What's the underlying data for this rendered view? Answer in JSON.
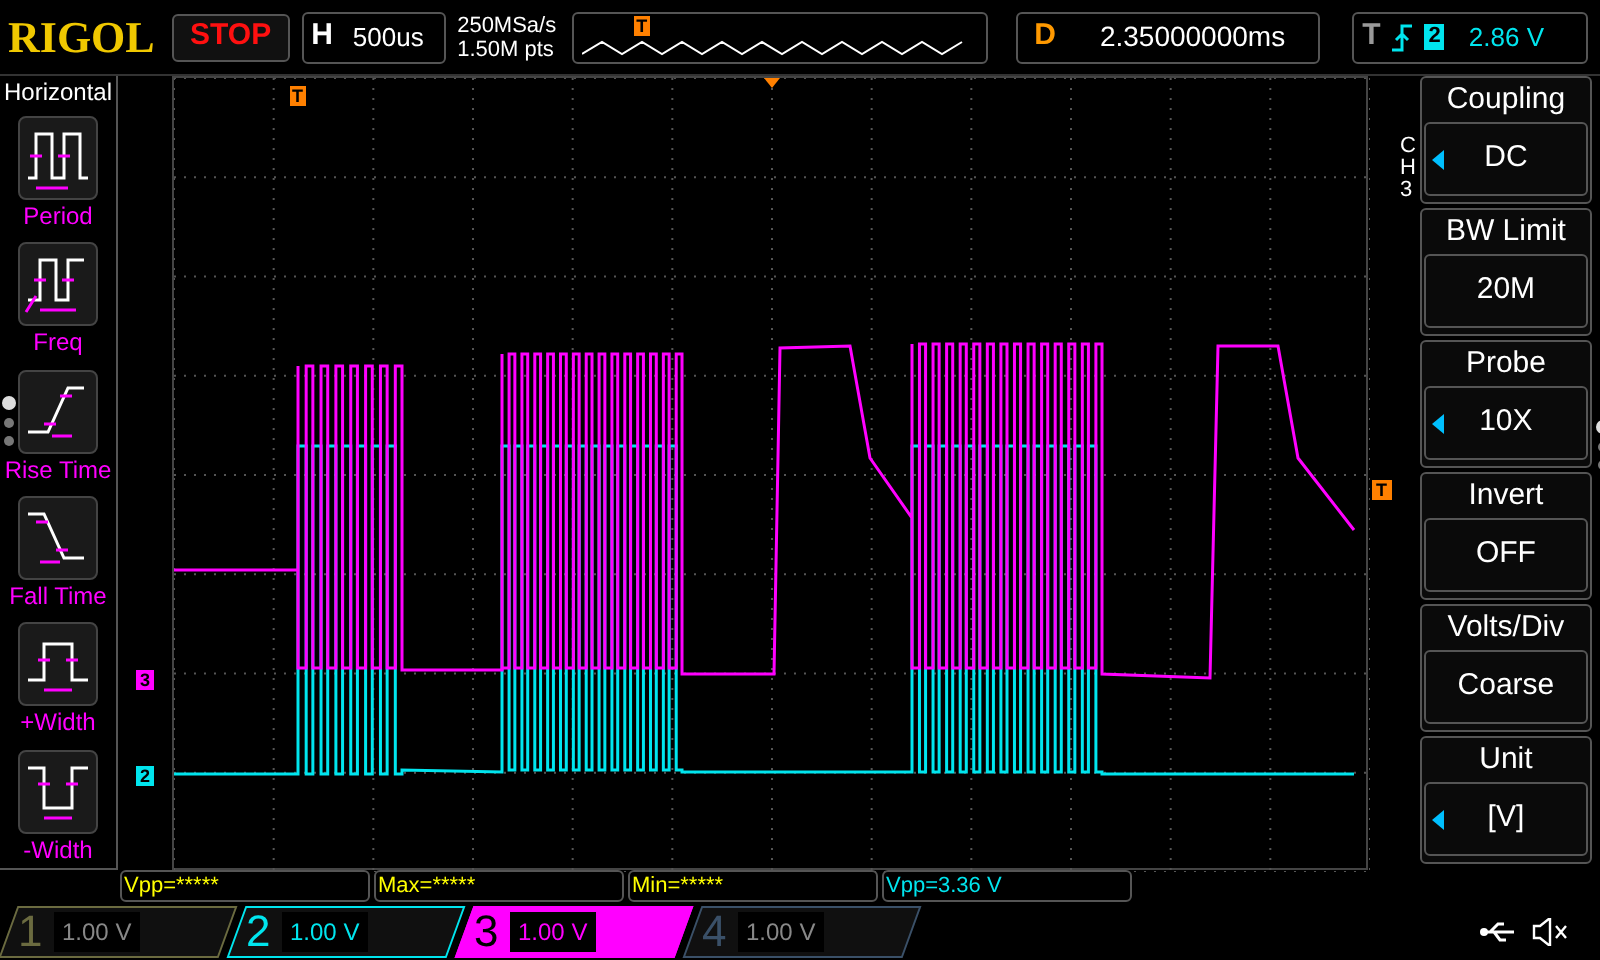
{
  "top_bar": {
    "logo": "RIGOL",
    "run_status": "STOP",
    "horizontal": {
      "label": "H",
      "timebase": "500us"
    },
    "sample_rate": "250MSa/s",
    "memory_depth": "1.50M pts",
    "delay": {
      "label": "D",
      "value": "2.35000000ms"
    },
    "trigger": {
      "label": "T",
      "source": "2",
      "level": "2.86 V"
    }
  },
  "memory_overview": {
    "trigger_marker": "T"
  },
  "plot": {
    "trigger_position_marker": "T",
    "trigger_level_marker": "T"
  },
  "channel_markers": [
    {
      "label": "3",
      "color": "#ff00ff"
    },
    {
      "label": "2",
      "color": "#00e5ee"
    }
  ],
  "left_menu": {
    "title": "Horizontal",
    "items": [
      {
        "kind": "period",
        "label": "Period"
      },
      {
        "kind": "freq",
        "label": "Freq"
      },
      {
        "kind": "rise",
        "label": "Rise Time"
      },
      {
        "kind": "fall",
        "label": "Fall Time"
      },
      {
        "kind": "pwidth",
        "label": "+Width"
      },
      {
        "kind": "nwidth",
        "label": "-Width"
      }
    ]
  },
  "right_menu": {
    "channel": "CH3",
    "items": [
      {
        "label": "Coupling",
        "value": "DC",
        "adjustable": true
      },
      {
        "label": "BW Limit",
        "value": "20M",
        "adjustable": false
      },
      {
        "label": "Probe",
        "value": "10X",
        "adjustable": true
      },
      {
        "label": "Invert",
        "value": "OFF",
        "adjustable": false
      },
      {
        "label": "Volts/Div",
        "value": "Coarse",
        "adjustable": false
      },
      {
        "label": "Unit",
        "value": "[V]",
        "adjustable": true
      }
    ]
  },
  "measurements": [
    {
      "text": "Vpp=*****",
      "color": "#ffff00"
    },
    {
      "text": "Max=*****",
      "color": "#ffff00"
    },
    {
      "text": "Min=*****",
      "color": "#ffff00"
    },
    {
      "text": "Vpp=3.36 V",
      "color": "#00e5ee"
    }
  ],
  "channels": [
    {
      "number": "1",
      "scale": "1.00 V",
      "on": false,
      "selected": false,
      "color": "#6b6b40"
    },
    {
      "number": "2",
      "scale": "1.00 V",
      "on": true,
      "selected": false,
      "color": "#00e5ee"
    },
    {
      "number": "3",
      "scale": "1.00 V",
      "on": true,
      "selected": true,
      "color": "#ff00ff"
    },
    {
      "number": "4",
      "scale": "1.00 V",
      "on": false,
      "selected": false,
      "color": "#3a5068"
    }
  ]
}
